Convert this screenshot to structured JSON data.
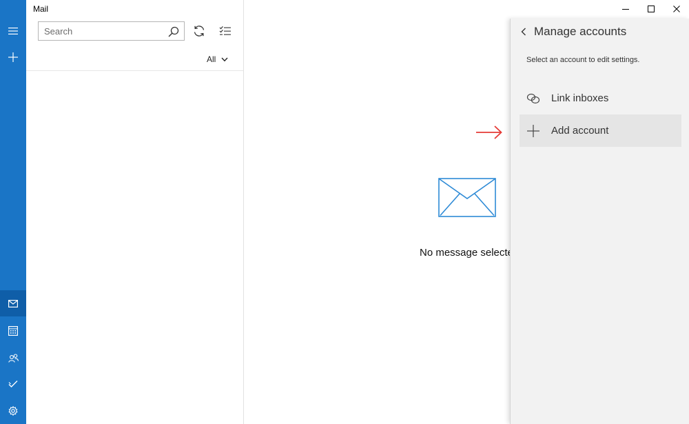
{
  "app": {
    "title": "Mail"
  },
  "search": {
    "placeholder": "Search",
    "value": ""
  },
  "filter": {
    "label": "All"
  },
  "reading_pane": {
    "empty_text": "No message selected"
  },
  "flyout": {
    "title": "Manage accounts",
    "subtitle": "Select an account to edit settings.",
    "items": [
      {
        "label": "Link inboxes",
        "icon": "link-icon"
      },
      {
        "label": "Add account",
        "icon": "plus-icon"
      }
    ]
  },
  "rail": {
    "top": [
      "hamburger-icon",
      "new-mail-icon"
    ],
    "bottom": [
      "mail-icon",
      "calendar-icon",
      "people-icon",
      "todo-icon",
      "settings-icon"
    ]
  },
  "colors": {
    "rail": "#1a75c6",
    "rail_active": "#0f5ea8",
    "accent": "#2d8ad6",
    "flyout_bg": "#f2f2f2",
    "annotation_arrow": "#e53935"
  }
}
